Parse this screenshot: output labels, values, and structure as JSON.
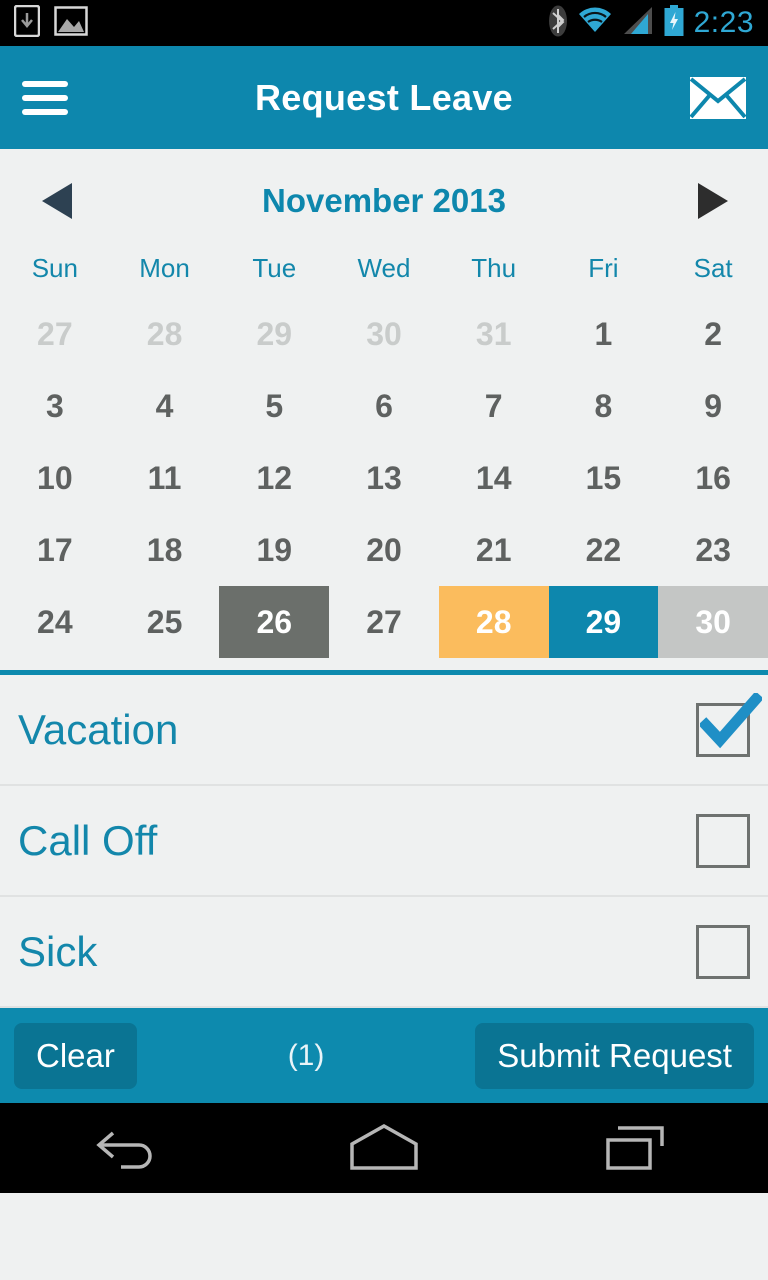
{
  "statusbar": {
    "icons_left": [
      "download-icon",
      "image-icon"
    ],
    "icons_right": [
      "bluetooth-icon",
      "wifi-icon",
      "cell-signal-icon",
      "battery-charging-icon"
    ],
    "time": "2:23",
    "time_color": "#2fa8d4",
    "background": "#000000"
  },
  "appbar": {
    "menu_icon": "hamburger-menu-icon",
    "title": "Request Leave",
    "mail_icon": "envelope-icon",
    "background": "#0d87ad",
    "text_color": "#ffffff"
  },
  "calendar": {
    "prev_icon": "triangle-left-icon",
    "next_icon": "triangle-right-icon",
    "month_label": "November 2013",
    "month_color": "#0d87ad",
    "weekdays": [
      "Sun",
      "Mon",
      "Tue",
      "Wed",
      "Thu",
      "Fri",
      "Sat"
    ],
    "weekday_color": "#1387ab",
    "weeks": [
      [
        {
          "n": "27",
          "state": "other"
        },
        {
          "n": "28",
          "state": "other"
        },
        {
          "n": "29",
          "state": "other"
        },
        {
          "n": "30",
          "state": "other"
        },
        {
          "n": "31",
          "state": "other"
        },
        {
          "n": "1",
          "state": "normal"
        },
        {
          "n": "2",
          "state": "normal"
        }
      ],
      [
        {
          "n": "3",
          "state": "normal"
        },
        {
          "n": "4",
          "state": "normal"
        },
        {
          "n": "5",
          "state": "normal"
        },
        {
          "n": "6",
          "state": "normal"
        },
        {
          "n": "7",
          "state": "normal"
        },
        {
          "n": "8",
          "state": "normal"
        },
        {
          "n": "9",
          "state": "normal"
        }
      ],
      [
        {
          "n": "10",
          "state": "normal"
        },
        {
          "n": "11",
          "state": "normal"
        },
        {
          "n": "12",
          "state": "normal"
        },
        {
          "n": "13",
          "state": "normal"
        },
        {
          "n": "14",
          "state": "normal"
        },
        {
          "n": "15",
          "state": "normal"
        },
        {
          "n": "16",
          "state": "normal"
        }
      ],
      [
        {
          "n": "17",
          "state": "normal"
        },
        {
          "n": "18",
          "state": "normal"
        },
        {
          "n": "19",
          "state": "normal"
        },
        {
          "n": "20",
          "state": "normal"
        },
        {
          "n": "21",
          "state": "normal"
        },
        {
          "n": "22",
          "state": "normal"
        },
        {
          "n": "23",
          "state": "normal"
        }
      ],
      [
        {
          "n": "24",
          "state": "normal"
        },
        {
          "n": "25",
          "state": "normal"
        },
        {
          "n": "26",
          "state": "fill-dark"
        },
        {
          "n": "27",
          "state": "normal"
        },
        {
          "n": "28",
          "state": "fill-amber"
        },
        {
          "n": "29",
          "state": "fill-teal"
        },
        {
          "n": "30",
          "state": "fill-grey"
        }
      ]
    ],
    "highlight_colors": {
      "fill-dark": "#6b6f6b",
      "fill-amber": "#fbbc5d",
      "fill-teal": "#0d87ad",
      "fill-grey": "#c4c6c5"
    },
    "divider_color": "#0d8aae"
  },
  "leave_types": [
    {
      "label": "Vacation",
      "checked": true,
      "checkbox_name": "vacation-checkbox"
    },
    {
      "label": "Call Off",
      "checked": false,
      "checkbox_name": "call-off-checkbox"
    },
    {
      "label": "Sick",
      "checked": false,
      "checkbox_name": "sick-checkbox"
    }
  ],
  "actionbar": {
    "clear_label": "Clear",
    "count_label": "(1)",
    "submit_label": "Submit Request",
    "background": "#0d8aae",
    "button_background": "#0a7493"
  },
  "navbar": {
    "back_icon": "back-arrow-icon",
    "home_icon": "home-icon",
    "recents_icon": "recent-apps-icon",
    "background": "#000000"
  }
}
